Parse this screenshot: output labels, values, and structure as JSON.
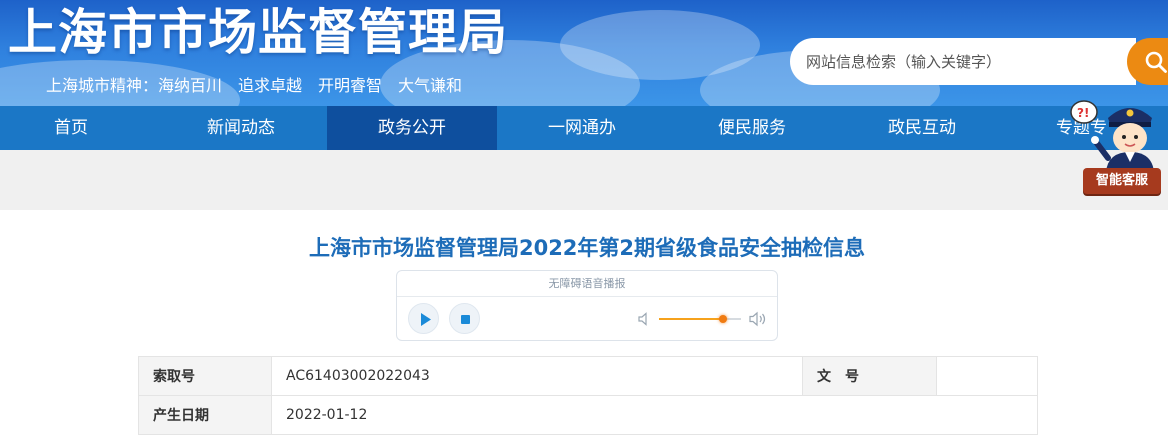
{
  "header": {
    "site_title": "上海市市场监督管理局",
    "slogan": "上海城市精神：海纳百川　追求卓越　开明睿智　大气谦和",
    "search": {
      "placeholder": "网站信息检索（输入关键字）"
    }
  },
  "nav": {
    "items": [
      {
        "label": "首页"
      },
      {
        "label": "新闻动态"
      },
      {
        "label": "政务公开",
        "active": true
      },
      {
        "label": "一网通办"
      },
      {
        "label": "便民服务"
      },
      {
        "label": "政民互动"
      },
      {
        "label": "专题专"
      }
    ]
  },
  "assistant": {
    "label": "智能客服",
    "badge": "?!"
  },
  "article": {
    "title": "上海市市场监督管理局2022年第2期省级食品安全抽检信息"
  },
  "audio": {
    "label": "无障碍语音播报",
    "volume": 0.78
  },
  "info_table": {
    "rows": [
      {
        "label1": "索取号",
        "value1": "AC61403002022043",
        "label2": "文　号",
        "value2": ""
      },
      {
        "label1": "产生日期",
        "value1": "2022-01-12"
      }
    ]
  },
  "colors": {
    "header_blue": "#2f80de",
    "nav_blue": "#1b77c6",
    "nav_active": "#0e4f9e",
    "search_orange": "#ec8a12",
    "title_blue": "#1d6cb8"
  },
  "icons": [
    "search-icon",
    "play-icon",
    "stop-icon",
    "volume-low-icon",
    "volume-high-icon",
    "assistant-avatar-icon"
  ]
}
